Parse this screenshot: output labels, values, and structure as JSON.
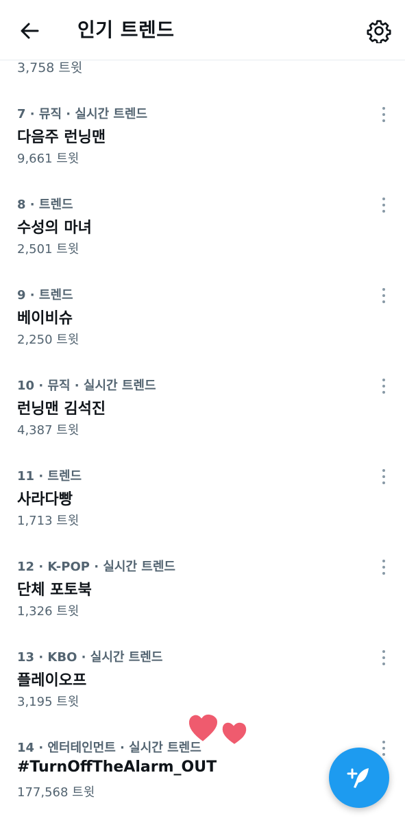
{
  "header": {
    "title": "인기 트렌드",
    "back_icon": "arrow-left-icon",
    "settings_icon": "gear-icon"
  },
  "partial_row": {
    "count": "3,758 트윗"
  },
  "trends": [
    {
      "meta": "7 · 뮤직 · 실시간 트렌드",
      "name": "다음주 런닝맨",
      "count": "9,661 트윗"
    },
    {
      "meta": "8 · 트렌드",
      "name": "수성의 마녀",
      "count": "2,501 트윗"
    },
    {
      "meta": "9 · 트렌드",
      "name": "베이비슈",
      "count": "2,250 트윗"
    },
    {
      "meta": "10 · 뮤직 · 실시간 트렌드",
      "name": "런닝맨 김석진",
      "count": "4,387 트윗"
    },
    {
      "meta": "11 · 트렌드",
      "name": "사라다빵",
      "count": "1,713 트윗"
    },
    {
      "meta": "12 · K-POP · 실시간 트렌드",
      "name": "단체 포토북",
      "count": "1,326 트윗"
    },
    {
      "meta": "13 · KBO · 실시간 트렌드",
      "name": "플레이오프",
      "count": "3,195 트윗"
    },
    {
      "meta": "14 · 엔터테인먼트 · 실시간 트렌드",
      "name": "#TurnOffTheAlarm_OUT",
      "count": "177,568 트윗"
    }
  ],
  "more_icon": "more-vertical-icon",
  "fab": {
    "icon": "compose-feather-icon"
  },
  "sticker": {
    "icon": "hearts-sticker-icon"
  },
  "colors": {
    "accent": "#1d9bf0",
    "primary_text": "#0f1419",
    "secondary_text": "#536471",
    "heart": "#ef5b6e"
  }
}
